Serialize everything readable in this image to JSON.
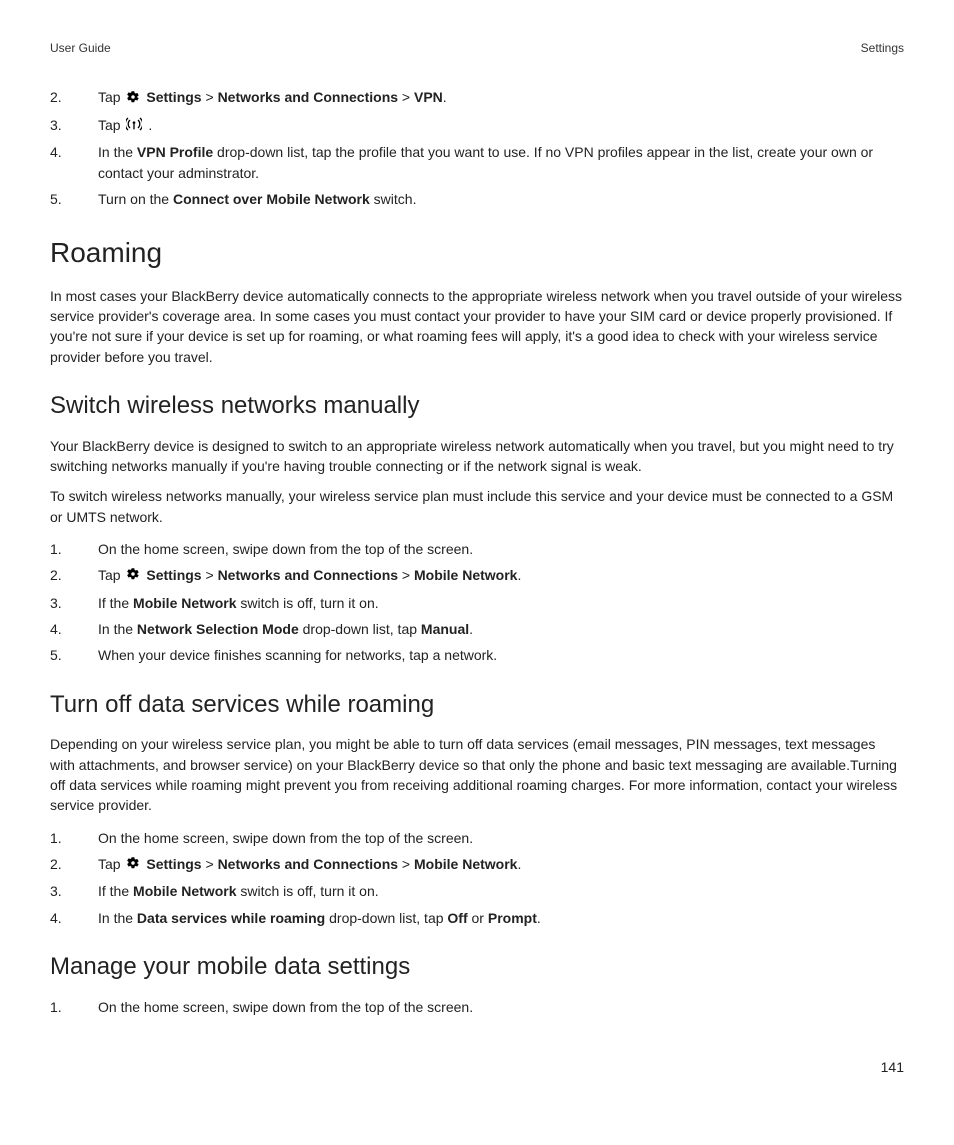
{
  "header": {
    "left": "User Guide",
    "right": "Settings"
  },
  "ol1": {
    "start": 2,
    "i2": {
      "pre": "Tap ",
      "post": " ",
      "b1": "Settings",
      "s1": " > ",
      "b2": "Networks and Connections",
      "s2": " > ",
      "b3": "VPN",
      "end": "."
    },
    "i3": {
      "pre": "Tap ",
      "post": " ."
    },
    "i4": {
      "pre": "In the ",
      "b1": "VPN Profile",
      "post": " drop-down list, tap the profile that you want to use. If no VPN profiles appear in the list, create your own or contact your adminstrator."
    },
    "i5": {
      "pre": "Turn on the ",
      "b1": "Connect over Mobile Network",
      "post": " switch."
    }
  },
  "h_roaming": "Roaming",
  "p_roaming": "In most cases your BlackBerry device automatically connects to the appropriate wireless network when you travel outside of your wireless service provider's coverage area. In some cases you must contact your provider to have your SIM card or device properly provisioned. If you're not sure if your device is set up for roaming, or what roaming fees will apply, it's a good idea to check with your wireless service provider before you travel.",
  "h_switch": "Switch wireless networks manually",
  "p_switch1": "Your BlackBerry device is designed to switch to an appropriate wireless network automatically when you travel, but you might need to try switching networks manually if you're having trouble connecting or if the network signal is weak.",
  "p_switch2": "To switch wireless networks manually, your wireless service plan must include this service and your device must be connected to a GSM or UMTS network.",
  "ol2": {
    "i1": "On the home screen, swipe down from the top of the screen.",
    "i2": {
      "pre": "Tap ",
      "b1": "Settings",
      "s1": " > ",
      "b2": "Networks and Connections",
      "s2": " > ",
      "b3": "Mobile Network",
      "end": "."
    },
    "i3": {
      "pre": "If the ",
      "b1": "Mobile Network",
      "post": " switch is off, turn it on."
    },
    "i4": {
      "pre": "In the ",
      "b1": "Network Selection Mode",
      "mid": " drop-down list, tap ",
      "b2": "Manual",
      "end": "."
    },
    "i5": "When your device finishes scanning for networks, tap a network."
  },
  "h_turnoff": "Turn off data services while roaming",
  "p_turnoff": "Depending on your wireless service plan, you might be able to turn off data services (email messages, PIN messages, text messages with attachments, and browser service) on your BlackBerry device so that only the phone and basic text messaging are available.Turning off data services while roaming might prevent you from receiving additional roaming charges. For more information, contact your wireless service provider.",
  "ol3": {
    "i1": "On the home screen, swipe down from the top of the screen.",
    "i2": {
      "pre": "Tap ",
      "b1": "Settings",
      "s1": " > ",
      "b2": "Networks and Connections",
      "s2": " > ",
      "b3": "Mobile Network",
      "end": "."
    },
    "i3": {
      "pre": "If the ",
      "b1": "Mobile Network",
      "post": " switch is off, turn it on."
    },
    "i4": {
      "pre": "In the ",
      "b1": "Data services while roaming",
      "mid": " drop-down list, tap ",
      "b2": "Off",
      "mid2": " or ",
      "b3": "Prompt",
      "end": "."
    }
  },
  "h_manage": "Manage your mobile data settings",
  "ol4": {
    "i1": "On the home screen, swipe down from the top of the screen."
  },
  "pagenum": "141"
}
